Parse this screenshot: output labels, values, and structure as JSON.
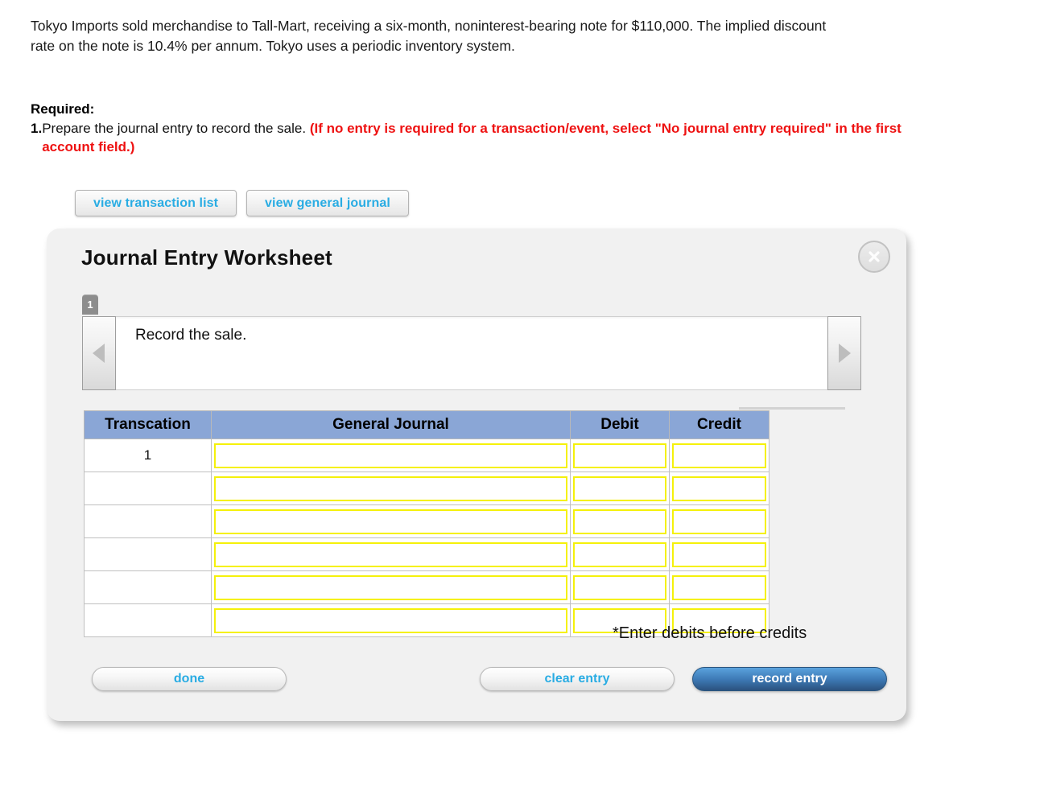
{
  "problem": {
    "text": "Tokyo Imports sold merchandise to Tall-Mart, receiving a six-month, noninterest-bearing note for $110,000. The implied discount rate on the note is 10.4% per annum. Tokyo uses a periodic inventory system."
  },
  "required": {
    "label": "Required:",
    "item_number": "1.",
    "item_text": "Prepare the journal entry to record the sale. ",
    "item_note": "(If no entry is required for a transaction/event, select \"No journal entry required\" in the first account field.)"
  },
  "top_buttons": {
    "view_transaction_list": "view transaction list",
    "view_general_journal": "view general journal"
  },
  "worksheet": {
    "title": "Journal Entry Worksheet",
    "close_label": "X",
    "tabs": [
      {
        "label": "1"
      }
    ],
    "prev_label": "previous",
    "next_label": "next",
    "description": "Record the sale.",
    "note": "*Enter debits before credits"
  },
  "table": {
    "headers": [
      "Transcation",
      "General Journal",
      "Debit",
      "Credit"
    ],
    "rows": [
      {
        "transaction": "1",
        "general_journal": "",
        "debit": "",
        "credit": ""
      },
      {
        "transaction": "",
        "general_journal": "",
        "debit": "",
        "credit": ""
      },
      {
        "transaction": "",
        "general_journal": "",
        "debit": "",
        "credit": ""
      },
      {
        "transaction": "",
        "general_journal": "",
        "debit": "",
        "credit": ""
      },
      {
        "transaction": "",
        "general_journal": "",
        "debit": "",
        "credit": ""
      },
      {
        "transaction": "",
        "general_journal": "",
        "debit": "",
        "credit": ""
      }
    ]
  },
  "footer_buttons": {
    "done": "done",
    "clear_entry": "clear entry",
    "record_entry": "record entry"
  },
  "colors": {
    "link_blue": "#29ace3",
    "alert_red": "#ee1111",
    "table_header_blue": "#8aa6d6",
    "input_border_yellow": "#f5f10a",
    "record_button_blue": "#3d79b5"
  }
}
